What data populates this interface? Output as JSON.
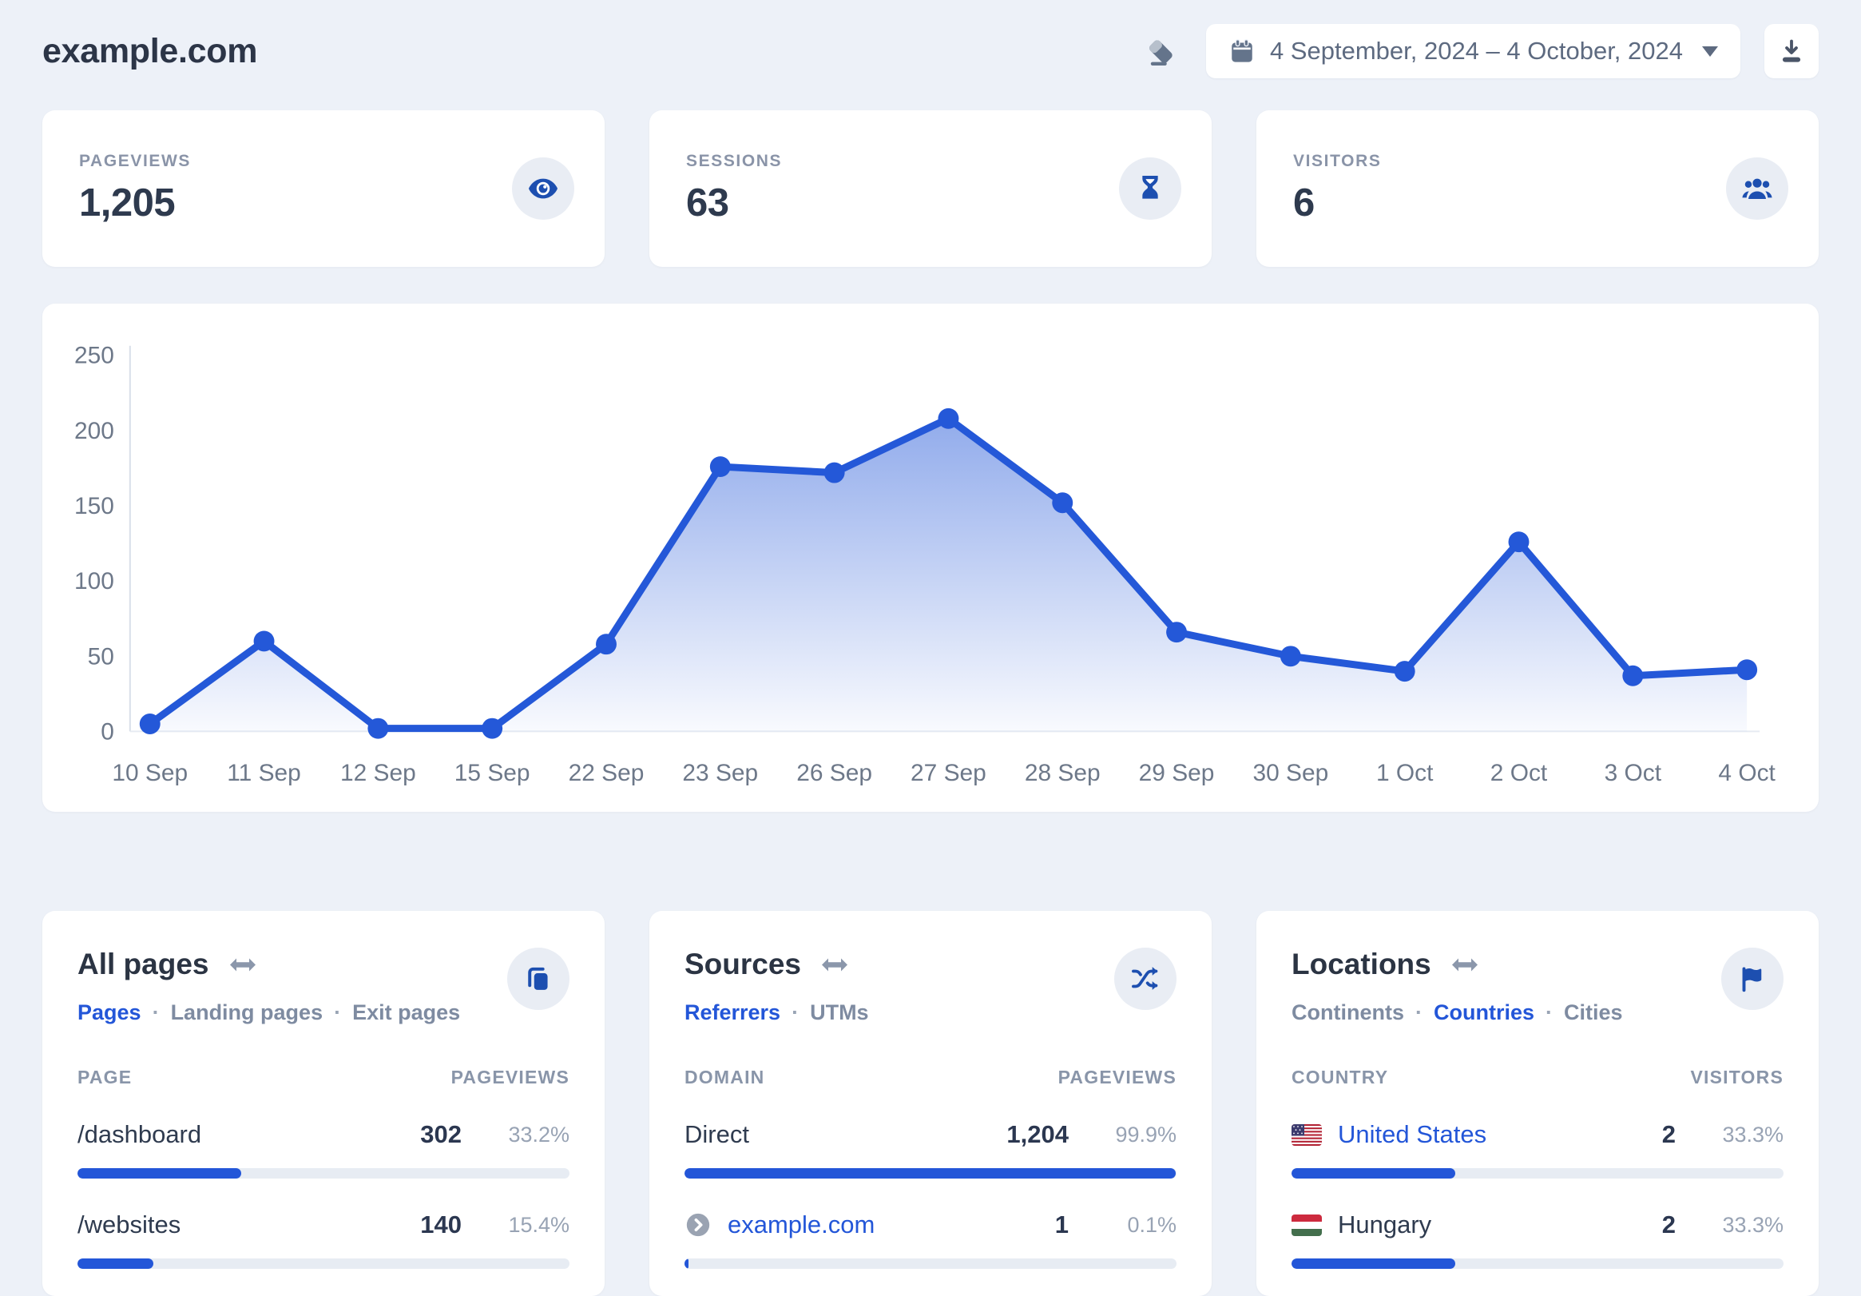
{
  "header": {
    "site_title": "example.com",
    "date_range": "4 September, 2024 – 4 October, 2024",
    "icons": [
      "eraser-icon",
      "calendar-icon",
      "caret-down-icon",
      "download-icon"
    ]
  },
  "stats": [
    {
      "label": "PAGEVIEWS",
      "value": "1,205",
      "icon": "eye-icon"
    },
    {
      "label": "SESSIONS",
      "value": "63",
      "icon": "hourglass-icon"
    },
    {
      "label": "VISITORS",
      "value": "6",
      "icon": "users-icon"
    }
  ],
  "chart_data": {
    "type": "area",
    "title": "",
    "xlabel": "",
    "ylabel": "",
    "x": [
      "10 Sep",
      "11 Sep",
      "12 Sep",
      "15 Sep",
      "22 Sep",
      "23 Sep",
      "26 Sep",
      "27 Sep",
      "28 Sep",
      "29 Sep",
      "30 Sep",
      "1 Oct",
      "2 Oct",
      "3 Oct",
      "4 Oct"
    ],
    "series": [
      {
        "name": "Pageviews",
        "values": [
          5,
          60,
          2,
          2,
          58,
          176,
          172,
          208,
          152,
          66,
          50,
          40,
          126,
          37,
          41
        ]
      }
    ],
    "ylim": [
      0,
      250
    ],
    "yticks": [
      0,
      50,
      100,
      150,
      200,
      250
    ],
    "grid": false,
    "legend": "none",
    "line_color": "#2458d8",
    "area_gradient": [
      "rgba(36,88,216,0.5)",
      "rgba(36,88,216,0.03)"
    ]
  },
  "panels": {
    "pages": {
      "title": "All pages",
      "icon": "copy-icon",
      "tabs": [
        {
          "label": "Pages",
          "active": true
        },
        {
          "label": "Landing pages",
          "active": false
        },
        {
          "label": "Exit pages",
          "active": false
        }
      ],
      "columns": [
        "PAGE",
        "PAGEVIEWS"
      ],
      "rows": [
        {
          "name": "/dashboard",
          "value": "302",
          "percent": "33.2%",
          "bar": 33.2
        },
        {
          "name": "/websites",
          "value": "140",
          "percent": "15.4%",
          "bar": 15.4
        }
      ]
    },
    "sources": {
      "title": "Sources",
      "icon": "shuffle-icon",
      "tabs": [
        {
          "label": "Referrers",
          "active": true
        },
        {
          "label": "UTMs",
          "active": false
        }
      ],
      "columns": [
        "DOMAIN",
        "PAGEVIEWS"
      ],
      "rows": [
        {
          "name": "Direct",
          "value": "1,204",
          "percent": "99.9%",
          "bar": 99.9
        },
        {
          "name": "example.com",
          "value": "1",
          "percent": "0.1%",
          "bar": 0.8,
          "icon": "chevron-circle-icon",
          "link": true
        }
      ]
    },
    "locations": {
      "title": "Locations",
      "icon": "flag-icon",
      "tabs": [
        {
          "label": "Continents",
          "active": false
        },
        {
          "label": "Countries",
          "active": true
        },
        {
          "label": "Cities",
          "active": false
        }
      ],
      "columns": [
        "COUNTRY",
        "VISITORS"
      ],
      "rows": [
        {
          "name": "United States",
          "value": "2",
          "percent": "33.3%",
          "bar": 33.3,
          "flag": "us",
          "link": true
        },
        {
          "name": "Hungary",
          "value": "2",
          "percent": "33.3%",
          "bar": 33.3,
          "flag": "hu"
        }
      ]
    }
  },
  "colors": {
    "accent": "#2356d8",
    "line": "#2458d8",
    "background": "#edf1f8",
    "card": "#ffffff",
    "icon_blue": "#1d4fb0",
    "muted_text": "#8a94a8",
    "bar_track": "#e7ecf3"
  }
}
